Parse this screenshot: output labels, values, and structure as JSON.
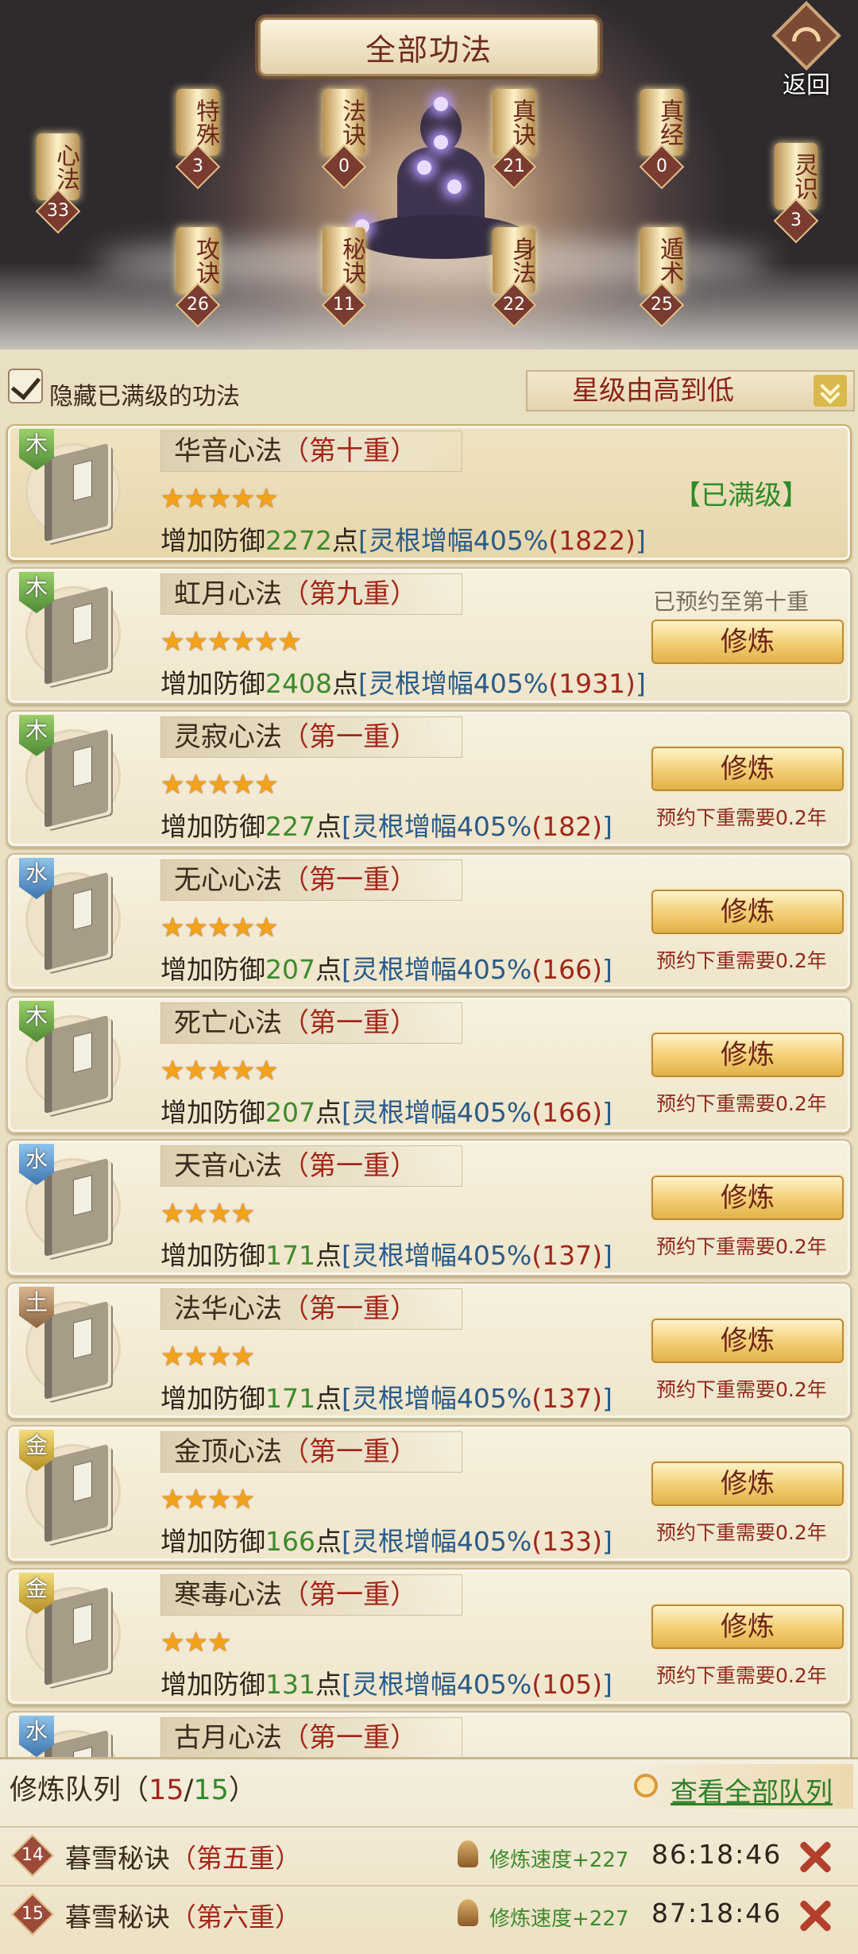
{
  "header": {
    "title": "全部功法",
    "back_label": "返回"
  },
  "categories": [
    {
      "name": "心法",
      "count": "33"
    },
    {
      "name": "特殊",
      "count": "3"
    },
    {
      "name": "攻诀",
      "count": "26"
    },
    {
      "name": "法诀",
      "count": "0"
    },
    {
      "name": "秘诀",
      "count": "11"
    },
    {
      "name": "真诀",
      "count": "21"
    },
    {
      "name": "身法",
      "count": "22"
    },
    {
      "name": "真经",
      "count": "0"
    },
    {
      "name": "遁术",
      "count": "25"
    },
    {
      "name": "灵识",
      "count": "3"
    }
  ],
  "filter": {
    "hide_maxed_label": "隐藏已满级的功法",
    "hide_maxed_checked": true,
    "sort_label": "星级由高到低"
  },
  "skills": [
    {
      "element": "木",
      "name": "华音心法",
      "level": "（第十重）",
      "stars": 5,
      "eff_prefix": "增加防御",
      "eff_value": "2272",
      "eff_unit": "点",
      "bonus_open": "[",
      "bonus_label": "灵根增幅405%",
      "bonus_value": "(1822)",
      "bonus_close": "]",
      "status": "【已满级】"
    },
    {
      "element": "木",
      "name": "虹月心法",
      "level": "（第九重）",
      "stars": 6,
      "eff_prefix": "增加防御",
      "eff_value": "2408",
      "eff_unit": "点",
      "bonus_open": "[",
      "bonus_label": "灵根增幅405%",
      "bonus_value": "(1931)",
      "bonus_close": "]",
      "reserved": "已预约至第十重",
      "button": "修炼"
    },
    {
      "element": "木",
      "name": "灵寂心法",
      "level": "（第一重）",
      "stars": 5,
      "eff_prefix": "增加防御",
      "eff_value": "227",
      "eff_unit": "点",
      "bonus_open": "[",
      "bonus_label": "灵根增幅405%",
      "bonus_value": "(182)",
      "bonus_close": "]",
      "button": "修炼",
      "wait": "预约下重需要0.2年"
    },
    {
      "element": "水",
      "name": "无心心法",
      "level": "（第一重）",
      "stars": 5,
      "eff_prefix": "增加防御",
      "eff_value": "207",
      "eff_unit": "点",
      "bonus_open": "[",
      "bonus_label": "灵根增幅405%",
      "bonus_value": "(166)",
      "bonus_close": "]",
      "button": "修炼",
      "wait": "预约下重需要0.2年"
    },
    {
      "element": "木",
      "name": "死亡心法",
      "level": "（第一重）",
      "stars": 5,
      "eff_prefix": "增加防御",
      "eff_value": "207",
      "eff_unit": "点",
      "bonus_open": "[",
      "bonus_label": "灵根增幅405%",
      "bonus_value": "(166)",
      "bonus_close": "]",
      "button": "修炼",
      "wait": "预约下重需要0.2年"
    },
    {
      "element": "水",
      "name": "天音心法",
      "level": "（第一重）",
      "stars": 4,
      "eff_prefix": "增加防御",
      "eff_value": "171",
      "eff_unit": "点",
      "bonus_open": "[",
      "bonus_label": "灵根增幅405%",
      "bonus_value": "(137)",
      "bonus_close": "]",
      "button": "修炼",
      "wait": "预约下重需要0.2年"
    },
    {
      "element": "土",
      "name": "法华心法",
      "level": "（第一重）",
      "stars": 4,
      "eff_prefix": "增加防御",
      "eff_value": "171",
      "eff_unit": "点",
      "bonus_open": "[",
      "bonus_label": "灵根增幅405%",
      "bonus_value": "(137)",
      "bonus_close": "]",
      "button": "修炼",
      "wait": "预约下重需要0.2年"
    },
    {
      "element": "金",
      "name": "金顶心法",
      "level": "（第一重）",
      "stars": 4,
      "eff_prefix": "增加防御",
      "eff_value": "166",
      "eff_unit": "点",
      "bonus_open": "[",
      "bonus_label": "灵根增幅405%",
      "bonus_value": "(133)",
      "bonus_close": "]",
      "button": "修炼",
      "wait": "预约下重需要0.2年"
    },
    {
      "element": "金",
      "name": "寒毒心法",
      "level": "（第一重）",
      "stars": 3,
      "eff_prefix": "增加防御",
      "eff_value": "131",
      "eff_unit": "点",
      "bonus_open": "[",
      "bonus_label": "灵根增幅405%",
      "bonus_value": "(105)",
      "bonus_close": "]",
      "button": "修炼",
      "wait": "预约下重需要0.2年"
    },
    {
      "element": "水",
      "name": "古月心法",
      "level": "（第一重）",
      "stars": 0
    }
  ],
  "queue": {
    "title": "修炼队列（",
    "current": "15",
    "sep": "/",
    "total": "15",
    "close": "）",
    "view_all": "查看全部队列",
    "items": [
      {
        "num": "14",
        "name": "暮雪秘诀",
        "level": "（第五重）",
        "speed": "修炼速度+227",
        "time": "86:18:46"
      },
      {
        "num": "15",
        "name": "暮雪秘诀",
        "level": "（第六重）",
        "speed": "修炼速度+227",
        "time": "87:18:46"
      }
    ]
  },
  "colors": {
    "wood": "#6aa846",
    "water": "#4f86c2",
    "earth": "#a57c55",
    "metal": "#d6ac2e",
    "accent_red": "#a1271a",
    "accent_green": "#2f8a2a"
  }
}
